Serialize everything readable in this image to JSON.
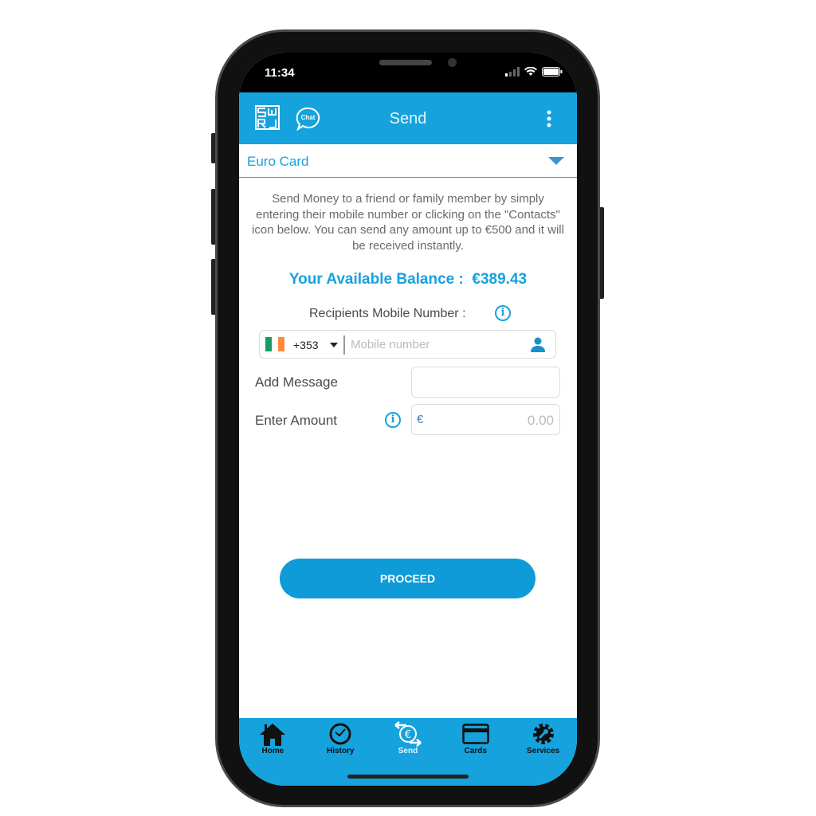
{
  "status_bar": {
    "time": "11:34"
  },
  "header": {
    "title": "Send",
    "logo_icon": "swrl-logo",
    "chat_label": "Chat",
    "menu_icon": "more-vertical-icon"
  },
  "card_select": {
    "selected": "Euro Card"
  },
  "description": "Send Money to a friend or family member by simply entering their mobile number or clicking on the \"Contacts\" icon below. You can send any amount up to €500 and it will be received instantly.",
  "balance": {
    "label": "Your Available Balance :",
    "value": "€389.43"
  },
  "recipient": {
    "label": "Recipients Mobile Number :",
    "country_code": "+353",
    "placeholder": "Mobile number",
    "flag_colors": [
      "#169b62",
      "#ffffff",
      "#ff883e"
    ]
  },
  "message": {
    "label": "Add Message",
    "value": ""
  },
  "amount": {
    "label": "Enter Amount",
    "currency": "€",
    "placeholder": "0.00"
  },
  "proceed_label": "PROCEED",
  "tabs": [
    {
      "label": "Home",
      "icon": "home-icon"
    },
    {
      "label": "History",
      "icon": "clock-icon"
    },
    {
      "label": "Send",
      "icon": "euro-exchange-icon",
      "active": true
    },
    {
      "label": "Cards",
      "icon": "card-icon"
    },
    {
      "label": "Services",
      "icon": "gear-wrench-icon"
    }
  ],
  "colors": {
    "accent": "#16a2dd",
    "button": "#0f9bd7"
  }
}
